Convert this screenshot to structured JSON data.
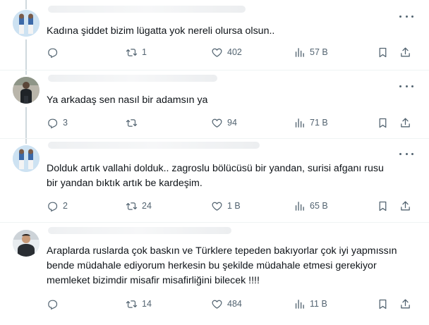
{
  "tweets": [
    {
      "text": "Kadına şiddet bizim lügatta yok nereli olursa olsun..",
      "reply_count": "",
      "repost_count": "1",
      "like_count": "402",
      "view_count": "57 B"
    },
    {
      "text": "Ya arkadaş sen nasıl bir adamsın ya",
      "reply_count": "3",
      "repost_count": "",
      "like_count": "94",
      "view_count": "71 B"
    },
    {
      "text": "Dolduk artık vallahi dolduk.. zagroslu bölücüsü bir yandan, surisi afganı rusu\nbir yandan bıktık artık be kardeşim.",
      "reply_count": "2",
      "repost_count": "24",
      "like_count": "1 B",
      "view_count": "65 B"
    },
    {
      "text": "Araplarda ruslarda çok baskın ve Türklere tepeden bakıyorlar çok iyi yapmıssın\nbende müdahale ediyorum herkesin bu şekilde müdahale etmesi gerekiyor\nmemleket bizimdir misafir misafirliğini bilecek !!!!",
      "reply_count": "",
      "repost_count": "14",
      "like_count": "484",
      "view_count": "11 B"
    }
  ],
  "icons": {
    "reply": "reply-icon",
    "repost": "repost-icon",
    "like": "heart-icon",
    "views": "views-icon",
    "bookmark": "bookmark-icon",
    "share": "share-icon",
    "more": "more-icon"
  },
  "colors": {
    "text": "#0f1419",
    "secondary": "#536471",
    "divider": "#eff3f4",
    "thread_line": "#cfd9de"
  }
}
